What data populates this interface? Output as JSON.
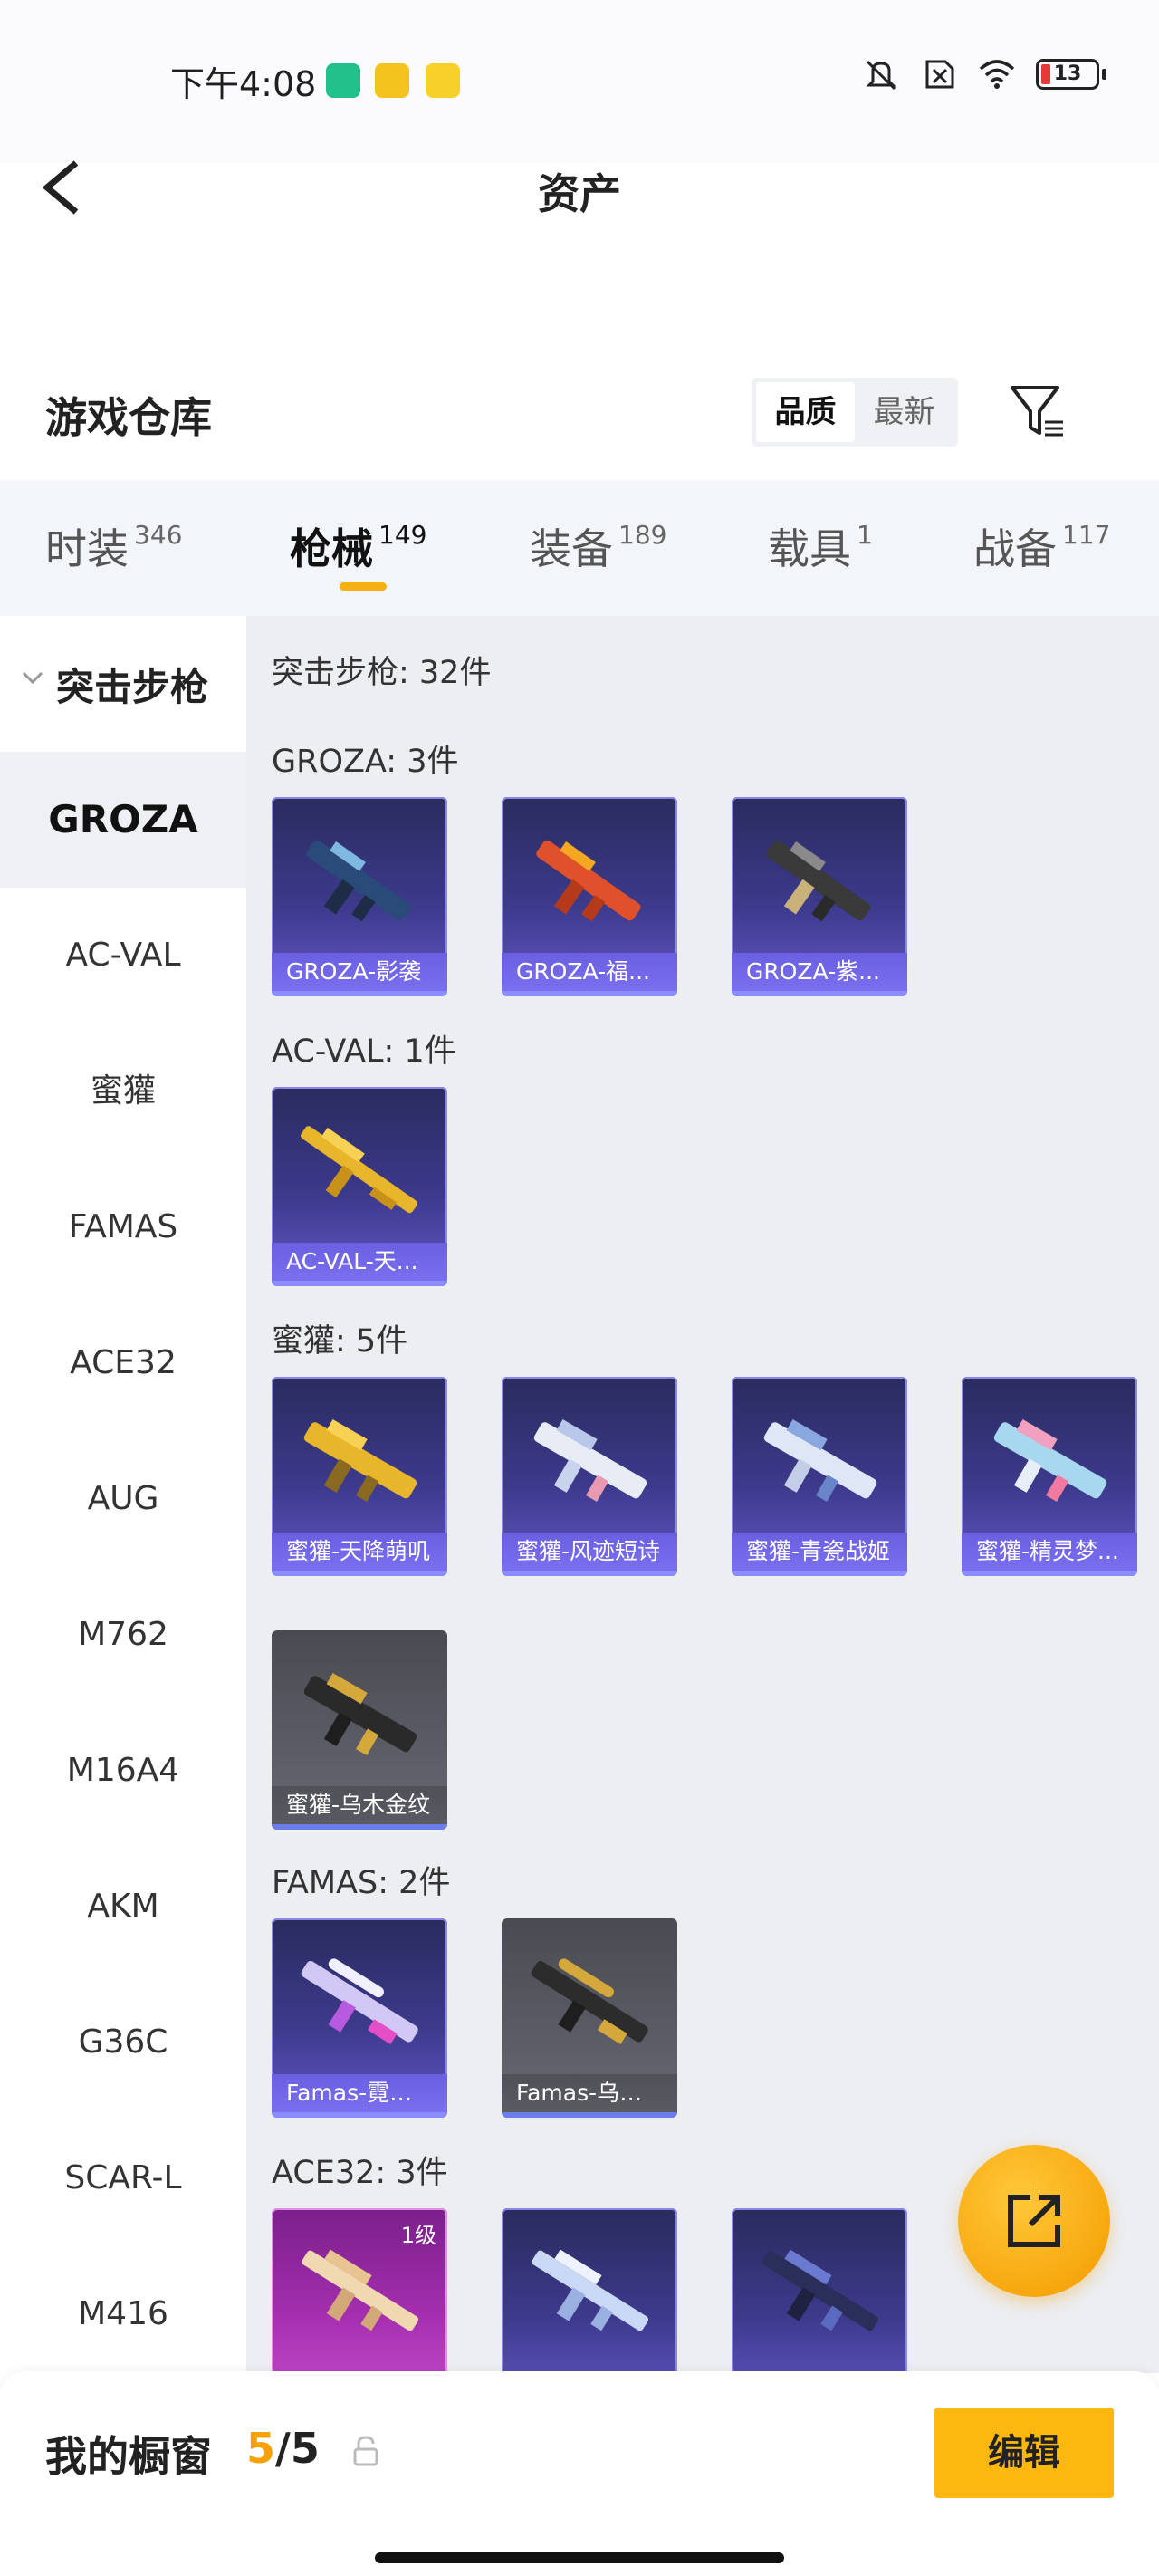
{
  "status_bar": {
    "time": "下午4:08",
    "battery": "13"
  },
  "header": {
    "title": "资产"
  },
  "warehouse": {
    "title": "游戏仓库",
    "sort_options": [
      "品质",
      "最新"
    ],
    "active_sort": "品质"
  },
  "tabs": [
    {
      "label": "时装",
      "count": "346"
    },
    {
      "label": "枪械",
      "count": "149"
    },
    {
      "label": "装备",
      "count": "189"
    },
    {
      "label": "载具",
      "count": "1"
    },
    {
      "label": "战备",
      "count": "117"
    }
  ],
  "active_tab": "枪械",
  "sidebar": {
    "category": "突击步枪",
    "items": [
      "GROZA",
      "AC-VAL",
      "蜜獾",
      "FAMAS",
      "ACE32",
      "AUG",
      "M762",
      "M16A4",
      "AKM",
      "G36C",
      "SCAR-L",
      "M416"
    ],
    "active_item": "GROZA"
  },
  "content": {
    "summary": "突击步枪: 32件",
    "groups": [
      {
        "label": "GROZA: 3件",
        "items": [
          {
            "name": "GROZA-影袭",
            "style": "purple"
          },
          {
            "name": "GROZA-福...",
            "style": "purple"
          },
          {
            "name": "GROZA-紫...",
            "style": "purple"
          }
        ]
      },
      {
        "label": "AC-VAL: 1件",
        "items": [
          {
            "name": "AC-VAL-天...",
            "style": "purple"
          }
        ]
      },
      {
        "label": "蜜獾: 5件",
        "items": [
          {
            "name": "蜜獾-天降萌叽",
            "style": "purple"
          },
          {
            "name": "蜜獾-风迹短诗",
            "style": "purple"
          },
          {
            "name": "蜜獾-青瓷战姬",
            "style": "purple"
          },
          {
            "name": "蜜獾-精灵梦...",
            "style": "purple"
          },
          {
            "name": "蜜獾-乌木金纹",
            "style": "gray"
          }
        ]
      },
      {
        "label": "FAMAS: 2件",
        "items": [
          {
            "name": "Famas-霓彩...",
            "style": "purple"
          },
          {
            "name": "Famas-乌木...",
            "style": "gray"
          }
        ]
      },
      {
        "label": "ACE32: 3件",
        "items": [
          {
            "name": "",
            "style": "pink",
            "level": "1级"
          },
          {
            "name": "",
            "style": "purple"
          },
          {
            "name": "",
            "style": "purple"
          }
        ]
      }
    ]
  },
  "bottom_bar": {
    "label": "我的橱窗",
    "current": "5",
    "separator": "/",
    "max": "5",
    "edit_label": "编辑"
  },
  "colors": {
    "accent": "#fcb80f",
    "tab_indicator": "#f5b013",
    "card_purple": "#3d3a8c",
    "card_gray": "#5c5c66",
    "card_pink": "#a52fb0"
  }
}
